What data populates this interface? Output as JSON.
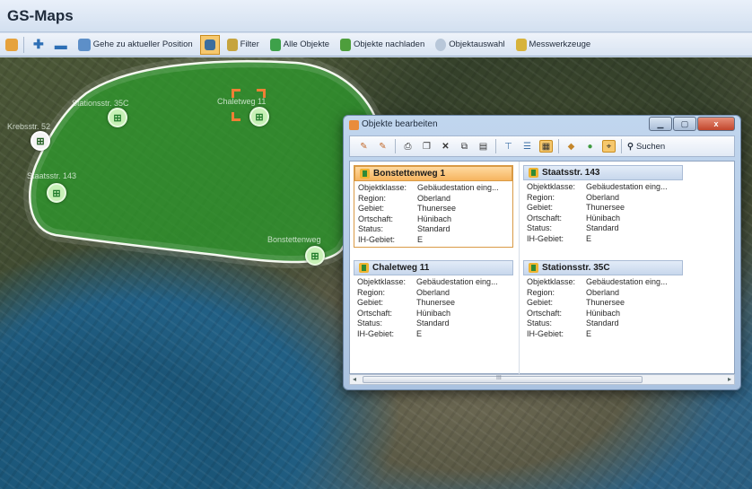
{
  "app": {
    "title": "GS-Maps"
  },
  "toolbar": {
    "goto_position": "Gehe zu aktueller Position",
    "filter": "Filter",
    "all_objects": "Alle Objekte",
    "reload_objects": "Objekte nachladen",
    "object_selection": "Objektauswahl",
    "measure_tools": "Messwerkzeuge"
  },
  "map": {
    "labels": [
      "Stationsstr. 35C",
      "Chaletweg 11",
      "Bonstettenweg",
      "Staatsstr. 143",
      "Krebsstr. 52"
    ]
  },
  "dialog": {
    "title": "Objekte bearbeiten",
    "close": "x",
    "search": "Suchen",
    "scroll_label": "III",
    "field_labels": {
      "objektklasse": "Objektklasse:",
      "region": "Region:",
      "gebiet": "Gebiet:",
      "ortschaft": "Ortschaft:",
      "status": "Status:",
      "ih_gebiet": "IH-Gebiet:"
    },
    "cards": [
      {
        "title": "Bonstettenweg 1",
        "objektklasse": "Gebäudestation eing...",
        "region": "Oberland",
        "gebiet": "Thunersee",
        "ortschaft": "Hünibach",
        "status": "Standard",
        "ih_gebiet": "E",
        "selected": true
      },
      {
        "title": "Staatsstr. 143",
        "objektklasse": "Gebäudestation eing...",
        "region": "Oberland",
        "gebiet": "Thunersee",
        "ortschaft": "Hünibach",
        "status": "Standard",
        "ih_gebiet": "E",
        "selected": false
      },
      {
        "title": "Chaletweg 11",
        "objektklasse": "Gebäudestation eing...",
        "region": "Oberland",
        "gebiet": "Thunersee",
        "ortschaft": "Hünibach",
        "status": "Standard",
        "ih_gebiet": "E",
        "selected": false
      },
      {
        "title": "Stationsstr. 35C",
        "objektklasse": "Gebäudestation eing...",
        "region": "Oberland",
        "gebiet": "Thunersee",
        "ortschaft": "Hünibach",
        "status": "Standard",
        "ih_gebiet": "E",
        "selected": false
      }
    ]
  },
  "colors": {
    "accent": "#f6b45f",
    "polygon": "#2fa02f",
    "selection": "#f07f35"
  }
}
